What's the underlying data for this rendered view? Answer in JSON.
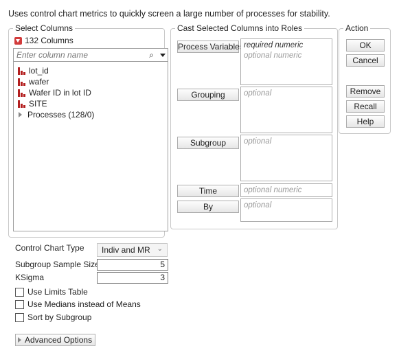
{
  "description": "Uses control chart metrics to quickly screen a large number of processes for stability.",
  "select_columns": {
    "title": "Select Columns",
    "count_label": "132 Columns",
    "search_placeholder": "Enter column name",
    "items": [
      {
        "label": "lot_id",
        "icon": "continuous-column-icon"
      },
      {
        "label": "wafer",
        "icon": "continuous-column-icon"
      },
      {
        "label": "Wafer ID in lot ID",
        "icon": "continuous-column-icon"
      },
      {
        "label": "SITE",
        "icon": "continuous-column-icon"
      },
      {
        "label": "Processes (128/0)",
        "icon": "expand-triangle-icon"
      }
    ]
  },
  "cast_roles": {
    "title": "Cast Selected Columns into Roles",
    "roles": [
      {
        "button": "Process Variables",
        "hint": "required numeric",
        "hint2": "optional numeric"
      },
      {
        "button": "Grouping",
        "hint": "optional"
      },
      {
        "button": "Subgroup",
        "hint": "optional"
      },
      {
        "button": "Time",
        "hint": "optional numeric"
      },
      {
        "button": "By",
        "hint": "optional"
      }
    ]
  },
  "action": {
    "title": "Action",
    "buttons": [
      "OK",
      "Cancel",
      "Remove",
      "Recall",
      "Help"
    ]
  },
  "options": {
    "chart_type_label": "Control Chart Type",
    "chart_type_value": "Indiv and MR",
    "sample_size_label": "Subgroup Sample Size",
    "sample_size_value": "5",
    "ksigma_label": "KSigma",
    "ksigma_value": "3",
    "checkboxes": [
      "Use Limits Table",
      "Use Medians instead of Means",
      "Sort by Subgroup"
    ],
    "advanced_label": "Advanced Options"
  }
}
